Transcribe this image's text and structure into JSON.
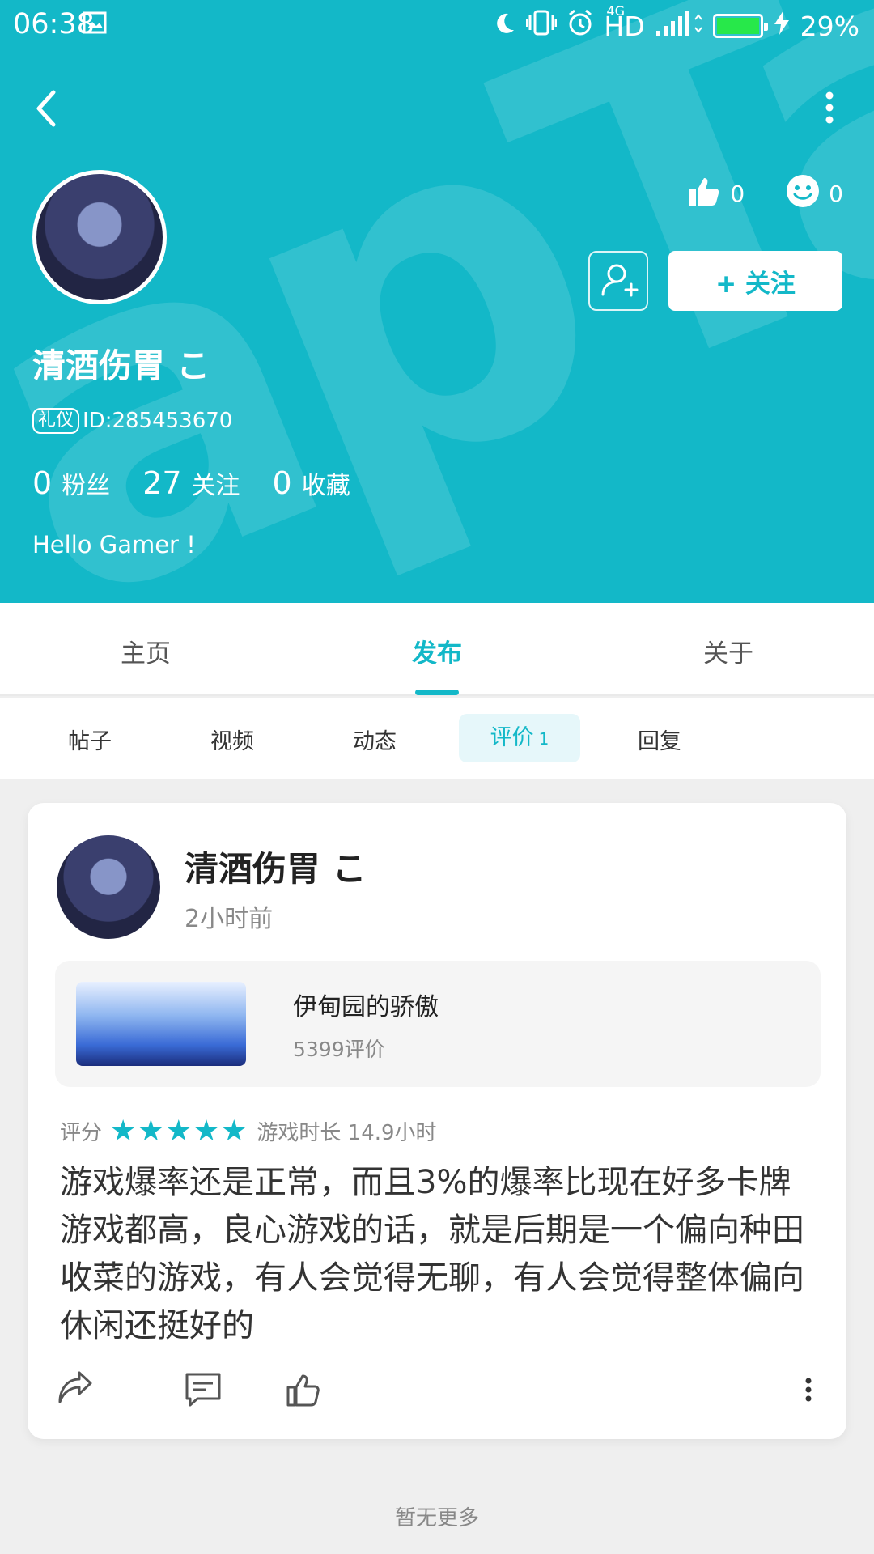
{
  "status_bar": {
    "time": "06:38",
    "hd": "HD",
    "network": "4G",
    "battery": "29%",
    "colors": {
      "bg": "#13b8c8",
      "battery_fill": "#27e84a"
    }
  },
  "header": {
    "username": "清酒伤胃 こ",
    "badge": "礼仪",
    "id_text": "ID:285453670",
    "likes_count": "0",
    "smile_count": "0",
    "stats": [
      {
        "num": "0",
        "label": "粉丝"
      },
      {
        "num": "27",
        "label": "关注"
      },
      {
        "num": "0",
        "label": "收藏"
      }
    ],
    "bio": "Hello Gamer !",
    "follow_label": "+ 关注"
  },
  "tabs": [
    "主页",
    "发布",
    "关于"
  ],
  "active_tab": 1,
  "subtabs": [
    "帖子",
    "视频",
    "动态",
    "评价",
    "回复"
  ],
  "subtab_count": "1",
  "review": {
    "username": "清酒伤胃 こ",
    "time": "2小时前",
    "game_name": "伊甸园的骄傲",
    "game_reviews": "5399评价",
    "score_label": "评分",
    "stars": 5,
    "stars_display": "★★★★★",
    "playtime": "游戏时长 14.9小时",
    "content": "游戏爆率还是正常，而且3%的爆率比现在好多卡牌游戏都高，良心游戏的话，就是后期是一个偏向种田收菜的游戏，有人会觉得无聊，有人会觉得整体偏向休闲还挺好的"
  },
  "footer": "暂无更多",
  "icons": {
    "back": "back-arrow-icon",
    "more": "more-vertical-icon",
    "thumb": "thumbs-up-icon",
    "smile": "smile-icon",
    "add_user": "add-user-icon",
    "share": "share-icon",
    "comment": "comment-icon",
    "like": "like-icon"
  },
  "accent": "#13b8c8"
}
